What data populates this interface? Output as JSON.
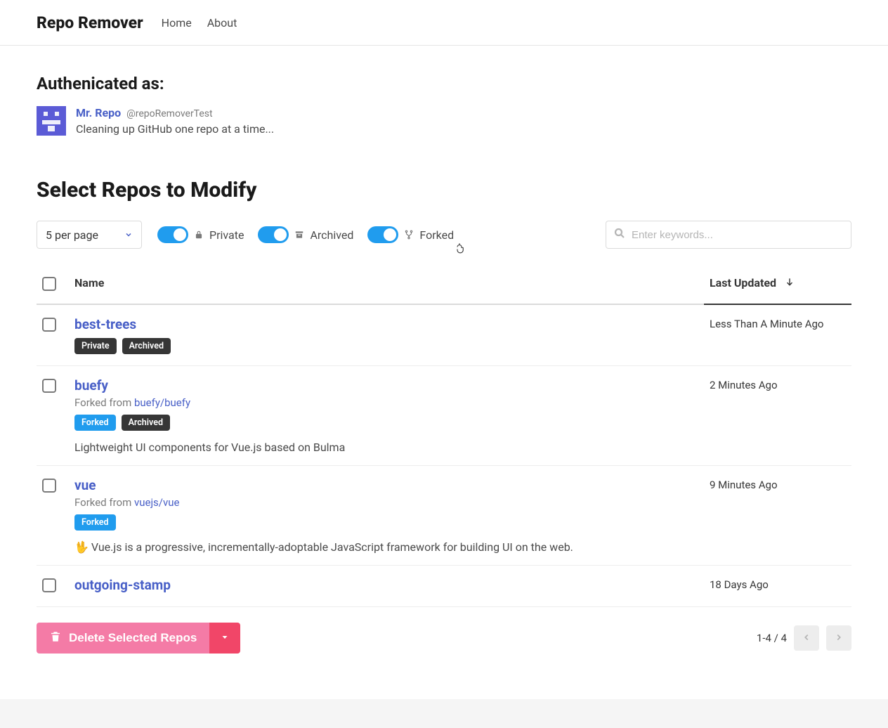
{
  "header": {
    "brand": "Repo Remover",
    "nav": {
      "home": "Home",
      "about": "About"
    }
  },
  "auth": {
    "heading": "Authenicated as:",
    "display_name": "Mr. Repo",
    "handle": "@repoRemoverTest",
    "bio": "Cleaning up GitHub one repo at a time..."
  },
  "section_title": "Select Repos to Modify",
  "perpage": {
    "label": "5 per page"
  },
  "filters": {
    "private": {
      "label": "Private",
      "on": true
    },
    "archived": {
      "label": "Archived",
      "on": true
    },
    "forked": {
      "label": "Forked",
      "on": true
    }
  },
  "search": {
    "placeholder": "Enter keywords..."
  },
  "table": {
    "columns": {
      "name": "Name",
      "updated": "Last Updated"
    },
    "rows": [
      {
        "name": "best-trees",
        "forked_from_prefix": "",
        "forked_from": "",
        "tags": [
          {
            "text": "Private",
            "style": "dark"
          },
          {
            "text": "Archived",
            "style": "dark"
          }
        ],
        "desc": "",
        "updated": "Less Than A Minute Ago"
      },
      {
        "name": "buefy",
        "forked_from_prefix": "Forked from ",
        "forked_from": "buefy/buefy",
        "tags": [
          {
            "text": "Forked",
            "style": "info"
          },
          {
            "text": "Archived",
            "style": "dark"
          }
        ],
        "desc": "Lightweight UI components for Vue.js based on Bulma",
        "updated": "2 Minutes Ago"
      },
      {
        "name": "vue",
        "forked_from_prefix": "Forked from ",
        "forked_from": "vuejs/vue",
        "tags": [
          {
            "text": "Forked",
            "style": "info"
          }
        ],
        "desc": "🖖 Vue.js is a progressive, incrementally-adoptable JavaScript framework for building UI on the web.",
        "updated": "9 Minutes Ago"
      },
      {
        "name": "outgoing-stamp",
        "forked_from_prefix": "",
        "forked_from": "",
        "tags": [],
        "desc": "",
        "updated": "18 Days Ago"
      }
    ]
  },
  "actions": {
    "delete_label": "Delete Selected Repos"
  },
  "pagination": {
    "info": "1-4 / 4"
  }
}
